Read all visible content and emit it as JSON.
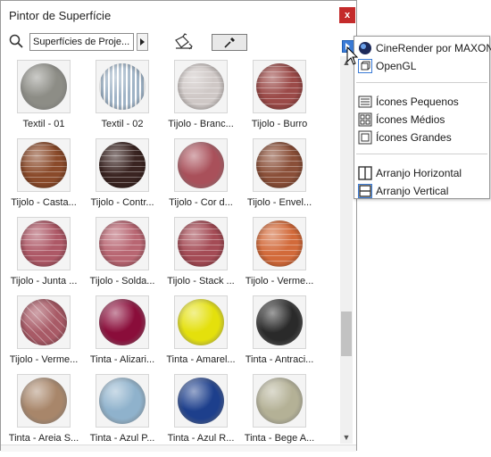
{
  "window": {
    "title": "Pintor de Superfície",
    "close_label": "x"
  },
  "toolbar": {
    "library_value": "Superfícies de Proje...",
    "search_icon": "search-icon",
    "paint_icon": "paint-bucket-icon",
    "eyedropper_icon": "eyedropper-icon"
  },
  "materials": [
    {
      "label": "Textil - 01",
      "color": "#8d8d86",
      "pattern": "plain"
    },
    {
      "label": "Textil - 02",
      "color": "#9fb3c6",
      "pattern": "stripes"
    },
    {
      "label": "Tijolo - Branc...",
      "color": "#cfc8c6",
      "pattern": "brick"
    },
    {
      "label": "Tijolo - Burro",
      "color": "#9b4a48",
      "pattern": "brick"
    },
    {
      "label": "Tijolo - Casta...",
      "color": "#8a4a2a",
      "pattern": "brick"
    },
    {
      "label": "Tijolo - Contr...",
      "color": "#3a2421",
      "pattern": "brick"
    },
    {
      "label": "Tijolo - Cor d...",
      "color": "#a9505a",
      "pattern": "plain"
    },
    {
      "label": "Tijolo - Envel...",
      "color": "#8a4f38",
      "pattern": "brick"
    },
    {
      "label": "Tijolo - Junta ...",
      "color": "#ad5866",
      "pattern": "brick"
    },
    {
      "label": "Tijolo - Solda...",
      "color": "#b86672",
      "pattern": "brick"
    },
    {
      "label": "Tijolo - Stack ...",
      "color": "#a44b55",
      "pattern": "brick"
    },
    {
      "label": "Tijolo - Verme...",
      "color": "#d26a3a",
      "pattern": "brick"
    },
    {
      "label": "Tijolo - Verme...",
      "color": "#a85a66",
      "pattern": "herringbone"
    },
    {
      "label": "Tinta - Alizari...",
      "color": "#8a0d3a",
      "pattern": "plain"
    },
    {
      "label": "Tinta - Amarel...",
      "color": "#e4e00c",
      "pattern": "plain"
    },
    {
      "label": "Tinta - Antraci...",
      "color": "#2a2a2a",
      "pattern": "plain"
    },
    {
      "label": "Tinta - Areia S...",
      "color": "#a8866a",
      "pattern": "plain"
    },
    {
      "label": "Tinta - Azul P...",
      "color": "#8fb2cc",
      "pattern": "plain"
    },
    {
      "label": "Tinta - Azul R...",
      "color": "#1d3f8c",
      "pattern": "plain"
    },
    {
      "label": "Tinta - Bege A...",
      "color": "#b4b196",
      "pattern": "plain"
    }
  ],
  "menu": {
    "items": [
      {
        "label": "CineRender por MAXON",
        "icon": "cinerender-icon"
      },
      {
        "label": "OpenGL",
        "icon": "opengl-icon"
      },
      {
        "label": "Ícones Pequenos",
        "icon": "small-icons-icon"
      },
      {
        "label": "Ícones Médios",
        "icon": "medium-icons-icon"
      },
      {
        "label": "Ícones Grandes",
        "icon": "large-icons-icon"
      },
      {
        "label": "Arranjo Horizontal",
        "icon": "horizontal-layout-icon"
      },
      {
        "label": "Arranjo Vertical",
        "icon": "vertical-layout-icon"
      }
    ]
  },
  "colors": {
    "accent": "#3b7bd6",
    "close": "#c42b2b"
  }
}
